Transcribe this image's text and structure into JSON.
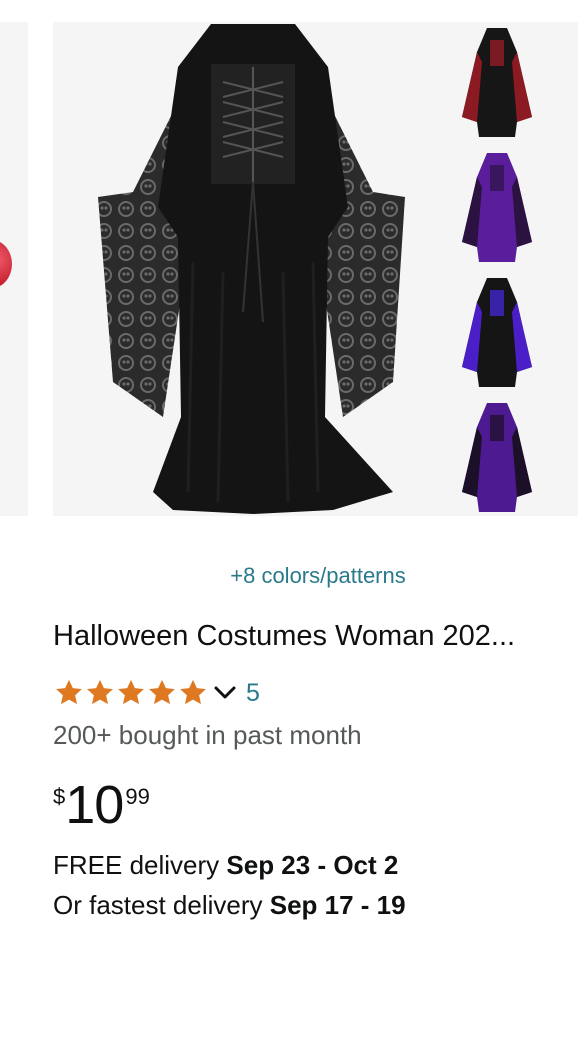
{
  "product": {
    "colors_link": "+8 colors/patterns",
    "title": "Halloween Costumes Woman 202...",
    "rating": {
      "stars": 5,
      "review_count": "5"
    },
    "bought_text": "200+ bought in past month",
    "price": {
      "symbol": "$",
      "whole": "10",
      "fraction": "99"
    },
    "delivery": {
      "free_prefix": "FREE delivery ",
      "free_dates": "Sep 23 - Oct 2",
      "fast_prefix": "Or fastest delivery ",
      "fast_dates": "Sep 17 - 19"
    },
    "swatches": [
      "black-red",
      "purple",
      "black-purple",
      "purple-black"
    ]
  },
  "colors": {
    "link": "#2a7a8c",
    "star": "#de7921",
    "muted_text": "#565959",
    "image_bg": "#f5f5f5"
  }
}
